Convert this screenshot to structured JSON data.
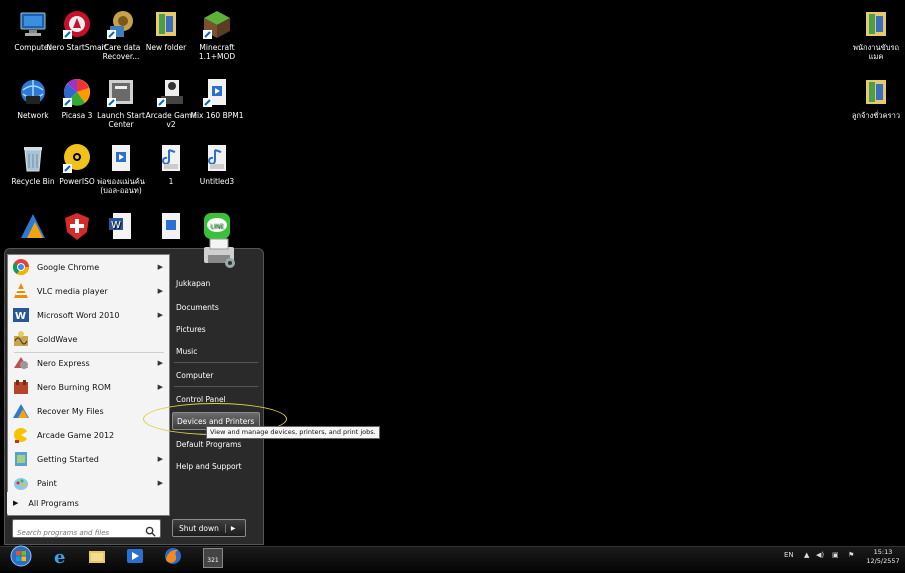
{
  "desktop": {
    "icons": [
      {
        "id": "computer",
        "label": "Computer",
        "icon": "computer-icon"
      },
      {
        "id": "nero-startsmart",
        "label": "Nero StartSmart",
        "icon": "nero-icon"
      },
      {
        "id": "icare",
        "label": "iCare data Recover...",
        "icon": "icare-icon"
      },
      {
        "id": "new-folder",
        "label": "New folder",
        "icon": "folder-icon"
      },
      {
        "id": "minecraft",
        "label": "Minecraft 1.1+MOD",
        "icon": "minecraft-icon"
      },
      {
        "id": "network",
        "label": "Network",
        "icon": "network-icon"
      },
      {
        "id": "picasa",
        "label": "Picasa 3",
        "icon": "picasa-icon"
      },
      {
        "id": "launch-start-center",
        "label": "Launch Start Center",
        "icon": "start-center-icon"
      },
      {
        "id": "arcade-game",
        "label": "Arcade Game v2",
        "icon": "arcade-icon"
      },
      {
        "id": "mix160",
        "label": "Mix 160 BPM1",
        "icon": "audio-file-icon"
      },
      {
        "id": "recycle-bin",
        "label": "Recycle Bin",
        "icon": "recycle-bin-icon"
      },
      {
        "id": "poweriso",
        "label": "PowerISO",
        "icon": "poweriso-icon"
      },
      {
        "id": "thai-file",
        "label": "พ่อของแม่นค้น (บอล-ออนท)",
        "icon": "audio-file-icon"
      },
      {
        "id": "wav1",
        "label": "1",
        "icon": "wav-icon"
      },
      {
        "id": "untitled3",
        "label": "Untitled3",
        "icon": "wav-icon"
      },
      {
        "id": "right-folder-1",
        "label": "พนักงานขับรถ แมค",
        "icon": "folder-icon"
      },
      {
        "id": "right-folder-2",
        "label": "ลูกจ้างชั่วคราว",
        "icon": "folder-icon"
      }
    ]
  },
  "start_menu": {
    "programs": [
      {
        "label": "Google Chrome",
        "icon": "chrome-icon",
        "has_arrow": true
      },
      {
        "label": "VLC media player",
        "icon": "vlc-icon",
        "has_arrow": true
      },
      {
        "label": "Microsoft Word 2010",
        "icon": "word-icon",
        "has_arrow": true
      },
      {
        "label": "GoldWave",
        "icon": "goldwave-icon",
        "has_arrow": false
      },
      {
        "label": "Nero Express",
        "icon": "nero-express-icon",
        "has_arrow": true
      },
      {
        "label": "Nero Burning ROM",
        "icon": "nero-burning-icon",
        "has_arrow": true
      },
      {
        "label": "Recover My Files",
        "icon": "recover-icon",
        "has_arrow": false
      },
      {
        "label": "Arcade Game 2012",
        "icon": "arcade-icon",
        "has_arrow": false
      },
      {
        "label": "Getting Started",
        "icon": "getting-started-icon",
        "has_arrow": true
      },
      {
        "label": "Paint",
        "icon": "paint-icon",
        "has_arrow": true
      }
    ],
    "all_programs": "All Programs",
    "search_placeholder": "Search programs and files",
    "right_items": [
      {
        "label": "Jukkapan"
      },
      {
        "label": "Documents"
      },
      {
        "label": "Pictures"
      },
      {
        "label": "Music"
      },
      {
        "label": "Computer"
      },
      {
        "label": "Control Panel"
      },
      {
        "label": "Devices and Printers",
        "highlighted": true
      },
      {
        "label": "Default Programs"
      },
      {
        "label": "Help and Support"
      }
    ],
    "shutdown_label": "Shut down",
    "tooltip": "View and manage devices, printers, and print jobs."
  },
  "taskbar": {
    "pinned": [
      "start-orb-icon",
      "ie-icon",
      "explorer-icon",
      "media-player-icon",
      "firefox-icon",
      "calendar-app-icon"
    ],
    "calendar_badge": "321",
    "language": "EN",
    "time": "15:13",
    "date": "12/5/2557"
  }
}
